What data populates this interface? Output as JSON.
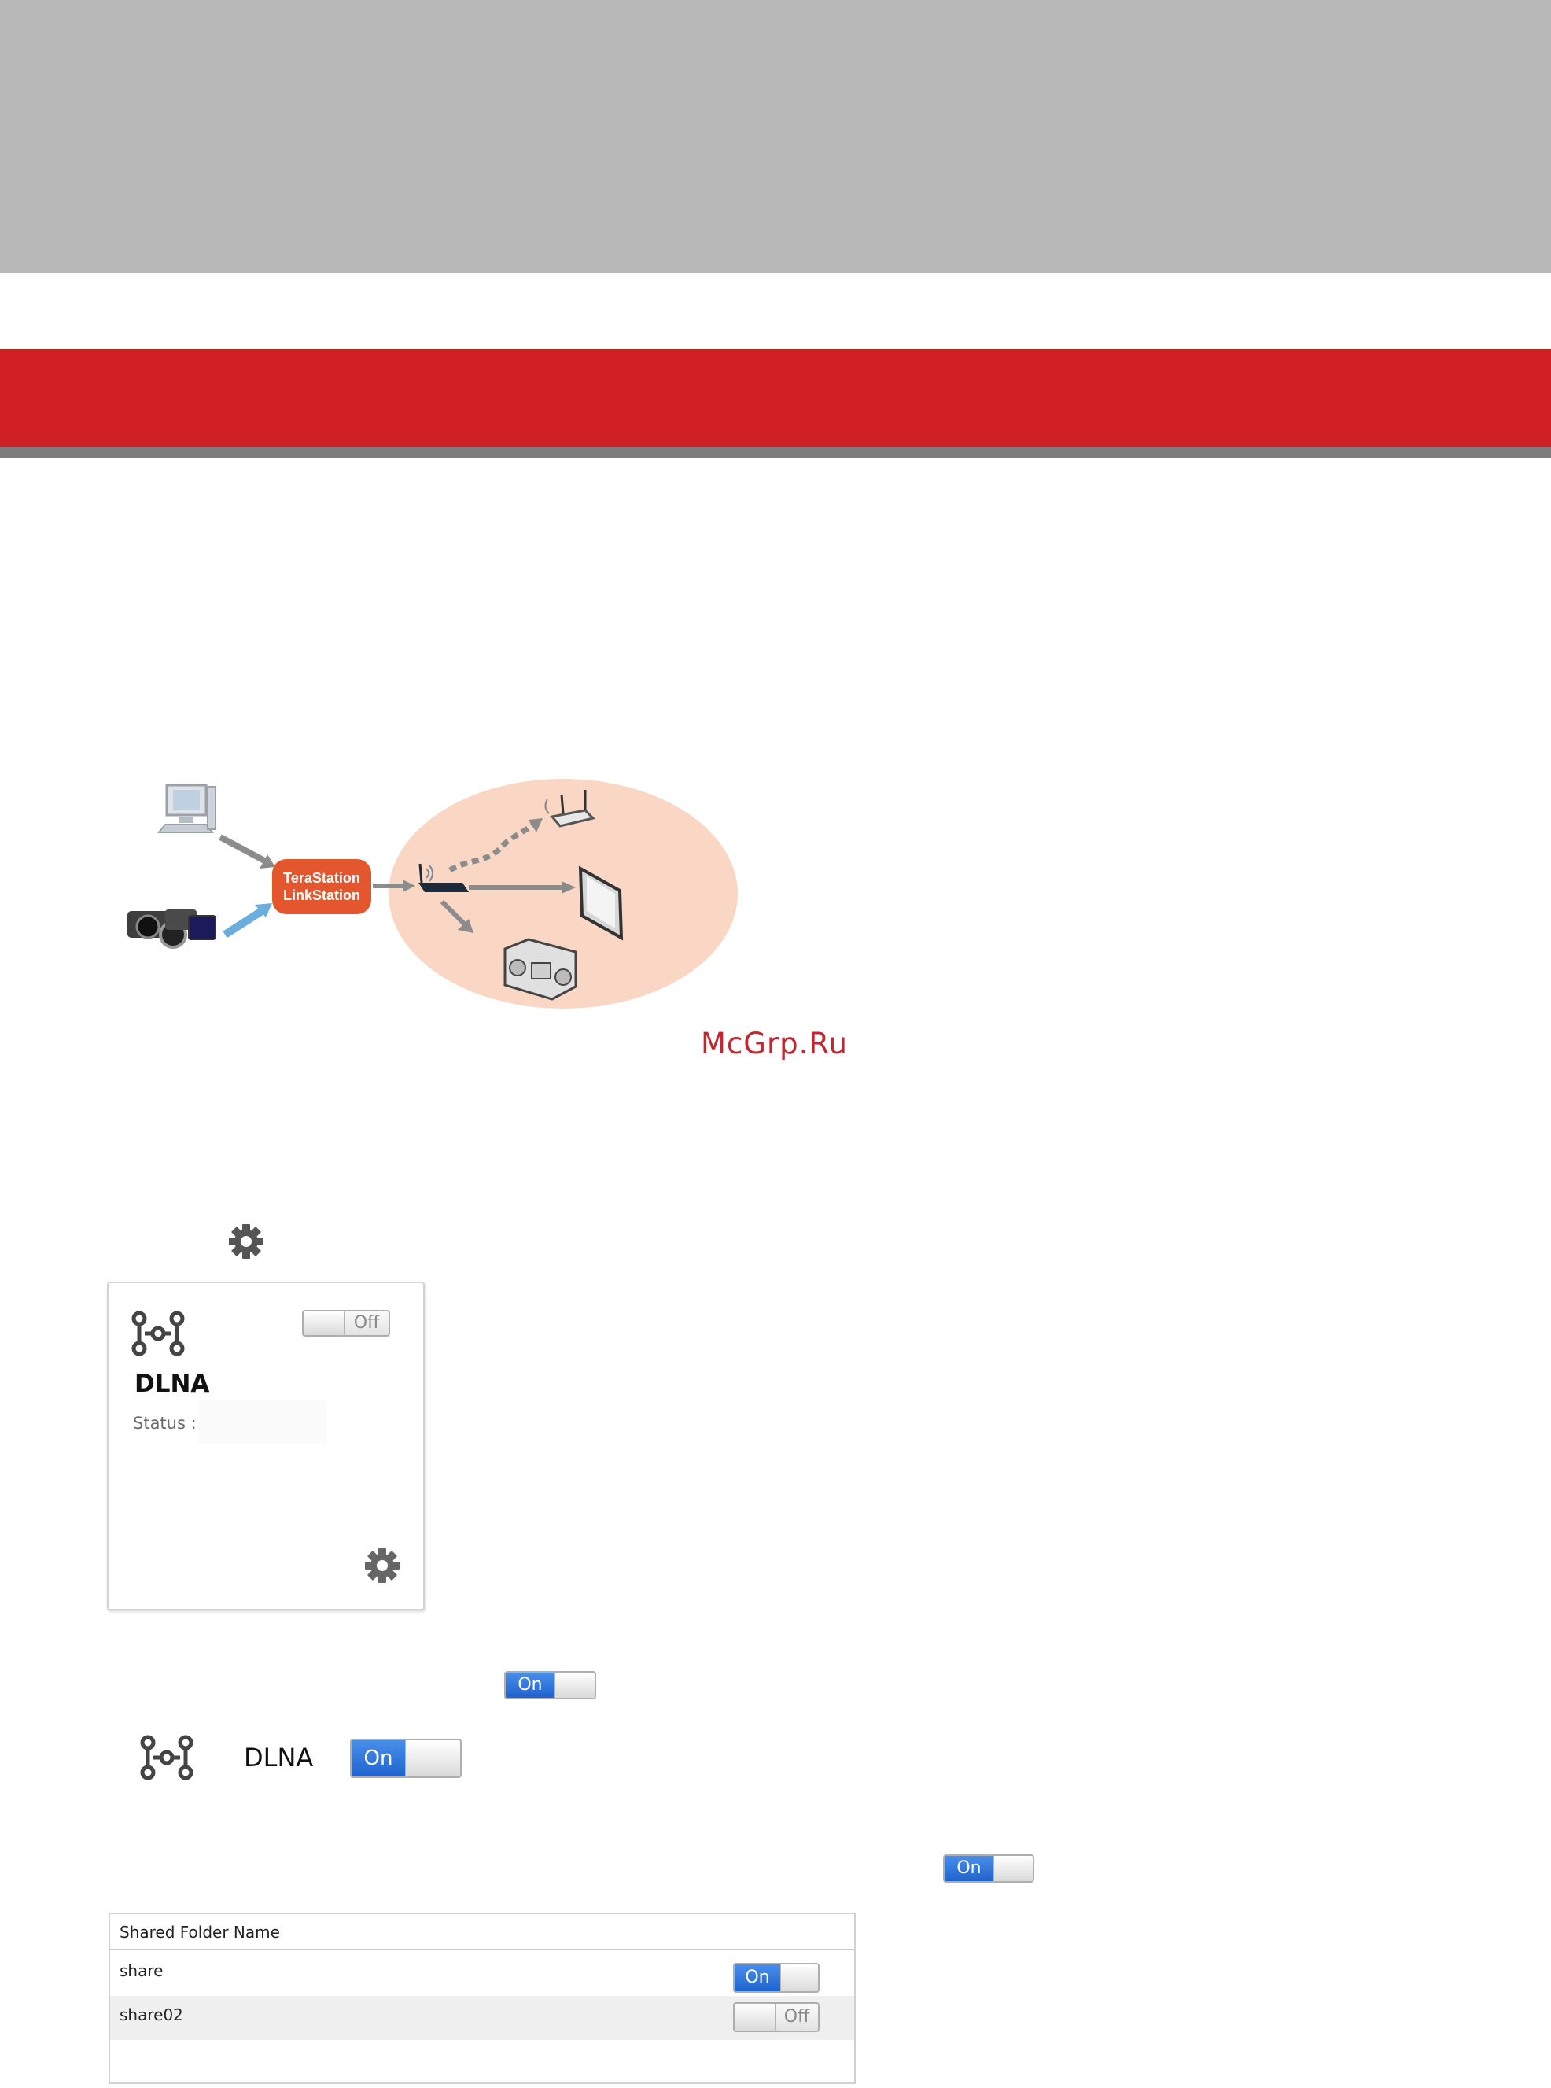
{
  "diagram": {
    "device_label_line1": "TeraStation",
    "device_label_line2": "LinkStation",
    "colors": {
      "device_badge": "#e4572e",
      "network_bubble": "#f9d7c4",
      "arrow_gray": "#8c8c8c",
      "arrow_blue": "#6aaee0"
    }
  },
  "watermark": "McGrp.Ru",
  "card": {
    "title": "DLNA",
    "status_label": "Status :",
    "status_value": "",
    "toggle_label": "Off"
  },
  "inline_toggle_1": {
    "label": "On"
  },
  "dlna_row": {
    "label": "DLNA",
    "toggle_label": "On"
  },
  "inline_toggle_2": {
    "label": "On"
  },
  "shared_table": {
    "header": "Shared Folder Name",
    "rows": [
      {
        "name": "share",
        "toggle": "On"
      },
      {
        "name": "share02",
        "toggle": "Off"
      }
    ]
  },
  "colors": {
    "red_bar": "#d11f26",
    "gray_banner": "#b9b9b9",
    "toggle_on": "#2f73dc"
  }
}
